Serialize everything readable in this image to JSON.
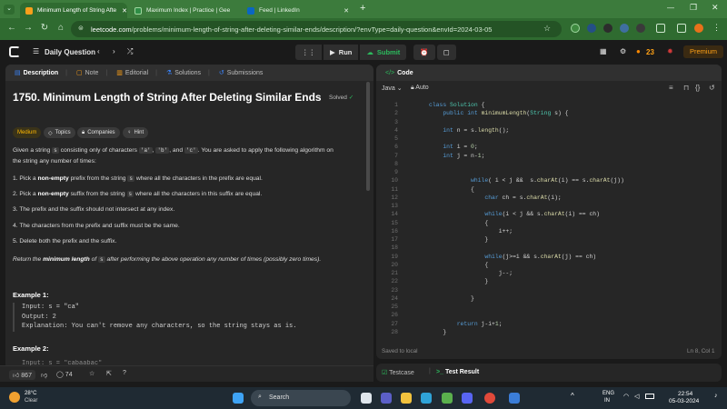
{
  "browser": {
    "tabs": [
      {
        "title": "Minimum Length of String Afte",
        "color": "#f89f1b"
      },
      {
        "title": "Maximum Index | Practice | Gee",
        "color": "#2f8d46"
      },
      {
        "title": "Feed | LinkedIn",
        "color": "#0a66c2",
        "icon_text": "in"
      }
    ],
    "url_host": "leetcode.com",
    "url_path": "/problems/minimum-length-of-string-after-deleting-similar-ends/description/?envType=daily-question&envId=2024-03-05",
    "new_tab_label": "+"
  },
  "lc_header": {
    "daily_label": "Daily Question",
    "run_label": "Run",
    "submit_label": "Submit",
    "streak": "23",
    "premium_label": "Premium"
  },
  "desc_tabs": [
    "Description",
    "Note",
    "Editorial",
    "Solutions",
    "Submissions"
  ],
  "problem": {
    "title": "1750. Minimum Length of String After Deleting Similar Ends",
    "solved_label": "Solved",
    "difficulty": "Medium",
    "chips": [
      "Topics",
      "Companies",
      "Hint"
    ],
    "intro_a": "Given a string",
    "intro_s": "s",
    "intro_b": "consisting only of characters",
    "char_a": "'a'",
    "char_b": "'b'",
    "and_word": ", and",
    "char_c": "'c'",
    "intro_c": ". You are asked to apply the following algorithm on",
    "intro_d": "the string any number of times:",
    "step1_a": "1. Pick a",
    "step1_b": "non-empty",
    "step1_c": "prefix from the string",
    "step1_d": "where all the characters in the prefix are equal.",
    "step2_a": "2. Pick a",
    "step2_b": "non-empty",
    "step2_c": "suffix from the string",
    "step2_d": "where all the characters in this suffix are equal.",
    "step3": "3. The prefix and the suffix should not intersect at any index.",
    "step4": "4. The characters from the prefix and suffix must be the same.",
    "step5": "5. Delete both the prefix and the suffix.",
    "ret_a": "Return the",
    "ret_b": "minimum length",
    "ret_c": "of",
    "ret_d": "after performing the above operation any number of times (possibly zero times).",
    "ex1_title": "Example 1:",
    "ex1_input": "Input: s = \"ca\"",
    "ex1_output": "Output: 2",
    "ex1_expl": "Explanation: You can't remove any characters, so the string stays as is.",
    "ex2_title": "Example 2:",
    "ex2_input": "Input: s = \"cabaabac\""
  },
  "desc_footer": {
    "likes": "867",
    "comments": "74"
  },
  "code_panel": {
    "tab_label": "Code",
    "language": "Java",
    "mode": "Auto",
    "status": "Saved to local",
    "cursor": "Ln 8, Col 1",
    "lines": [
      "class Solution {",
      "    public int minimumLength(String s) {",
      "",
      "    int n = s.length();",
      "",
      "    int i = 0;",
      "    int j = n-1;",
      "",
      "",
      "            while( i < j &&  s.charAt(i) == s.charAt(j))",
      "            {",
      "                char ch = s.charAt(i);",
      "",
      "                while(i < j && s.charAt(i) == ch)",
      "                {",
      "                    i++;",
      "                }",
      "",
      "                while(j>=i && s.charAt(j) == ch)",
      "                {",
      "                    j--;",
      "                }",
      "",
      "            }",
      "",
      "",
      "        return j-i+1;",
      "    }"
    ]
  },
  "bottom_tabs": {
    "testcase": "Testcase",
    "result": "Test Result"
  },
  "taskbar": {
    "temp": "28°C",
    "weather": "Clear",
    "search": "Search",
    "lang": "ENG",
    "region": "IN",
    "time": "22:54",
    "date": "05-03-2024"
  }
}
